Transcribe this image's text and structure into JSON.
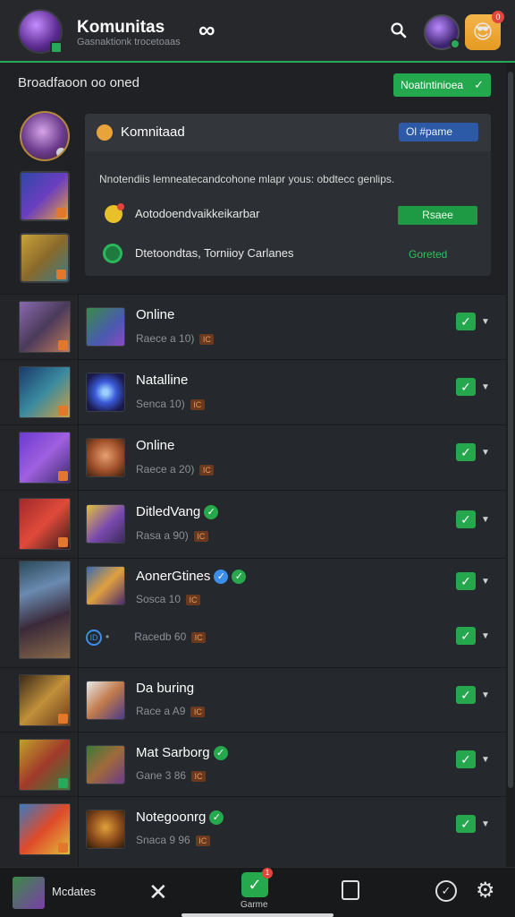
{
  "header": {
    "title": "Komunitas",
    "subtitle": "Gasnaktionk trocetoaas",
    "infinity": "∞",
    "notification_count": "0"
  },
  "section": {
    "title": "Broadfaoon oo oned",
    "chip_label": "Noatintinioea",
    "chip_check": "✓"
  },
  "card": {
    "title": "Komnitaad",
    "pill": "Ol  #pame",
    "description": "Nnotendiis lemneatecandcohone mlapr yous: obdtecc genlips.",
    "row1_text": "Aotodoendvaikkeikarbar",
    "row1_button": "Rsaee",
    "row2_text": "Dtetoondtas, Torniioy Carlanes",
    "row2_status": "Goreted"
  },
  "list": [
    {
      "name": "Online",
      "meta": "Raece a 10)",
      "tag": "IC",
      "verified": ""
    },
    {
      "name": "Natalline",
      "meta": "Senca 10)",
      "tag": "IC",
      "verified": ""
    },
    {
      "name": "Online",
      "meta": "Raece a 20)",
      "tag": "IC",
      "verified": ""
    },
    {
      "name": "DitledVang",
      "meta": "Rasa a 90)",
      "tag": "IC",
      "verified": "✓"
    },
    {
      "name": "AonerGtines",
      "meta": "Sosca 10",
      "tag": "IC",
      "verified": "✓"
    },
    {
      "name": "",
      "meta": "Racedb 60",
      "tag": "IC",
      "verified": "",
      "circle_icon": "ID"
    },
    {
      "name": "Da buring",
      "meta": "Race a A9",
      "tag": "IC",
      "verified": ""
    },
    {
      "name": "Mat Sarborg",
      "meta": "Gane 3 86",
      "tag": "IC",
      "verified": "✓"
    },
    {
      "name": "Notegoonrg",
      "meta": "Snaca 9 96",
      "tag": "IC",
      "verified": "✓"
    }
  ],
  "toggle_check": "✓",
  "caret": "▼",
  "bottom_nav": {
    "label": "Mcdates",
    "close_icon": "✕",
    "game_label": "Garme",
    "game_count": "1",
    "game_check": "✓",
    "check_icon": "✓",
    "gear_icon": "⚙"
  },
  "colors": {
    "accent_green": "#24a84d",
    "pill_blue": "#2d5aa6",
    "background": "#1f2124"
  }
}
